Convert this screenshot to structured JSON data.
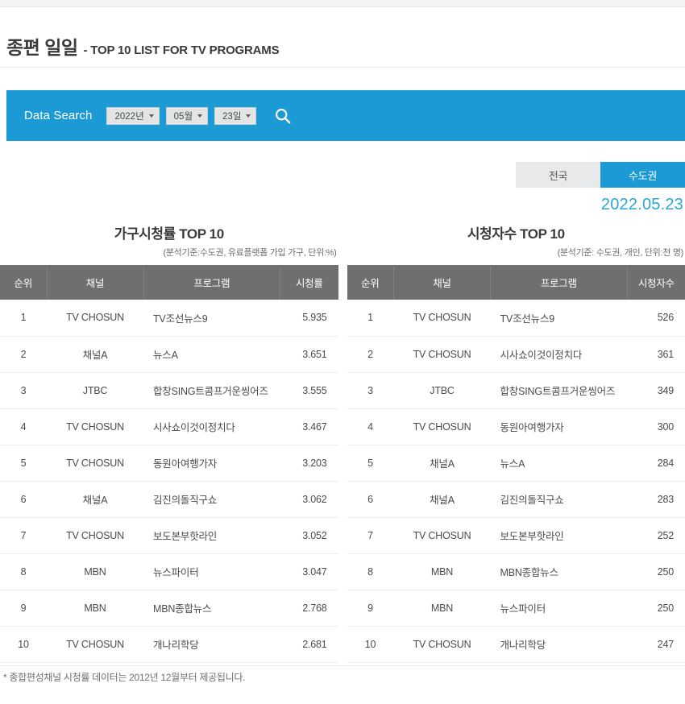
{
  "header": {
    "title_kr": "종편 일일",
    "title_en": "- TOP 10 LIST FOR TV PROGRAMS"
  },
  "search": {
    "label": "Data Search",
    "year": "2022년",
    "month": "05월",
    "day": "23일",
    "search_icon": "search-icon",
    "accent_color": "#1c9ad6"
  },
  "tabs": {
    "nationwide": "전국",
    "metropolitan": "수도권",
    "active": "수도권",
    "active_color": "#1c9ad6",
    "inactive_color": "#e8e9ea"
  },
  "date_label": "2022.05.23",
  "tables": [
    {
      "title": "가구시청률 TOP 10",
      "subtitle": "(분석기준:수도권, 유료플랫폼 가입 가구, 단위:%)",
      "columns": [
        "순위",
        "채널",
        "프로그램",
        "시청률"
      ],
      "rows": [
        {
          "rank": "1",
          "channel": "TV CHOSUN",
          "program": "TV조선뉴스9",
          "value": "5.935"
        },
        {
          "rank": "2",
          "channel": "채널A",
          "program": "뉴스A",
          "value": "3.651"
        },
        {
          "rank": "3",
          "channel": "JTBC",
          "program": "합창SING트콤프거운씽어즈",
          "value": "3.555"
        },
        {
          "rank": "4",
          "channel": "TV CHOSUN",
          "program": "시사쇼이것이정치다",
          "value": "3.467"
        },
        {
          "rank": "5",
          "channel": "TV CHOSUN",
          "program": "동원아여행가자",
          "value": "3.203"
        },
        {
          "rank": "6",
          "channel": "채널A",
          "program": "김진의돌직구쇼",
          "value": "3.062"
        },
        {
          "rank": "7",
          "channel": "TV CHOSUN",
          "program": "보도본부핫라인",
          "value": "3.052"
        },
        {
          "rank": "8",
          "channel": "MBN",
          "program": "뉴스파이터",
          "value": "3.047"
        },
        {
          "rank": "9",
          "channel": "MBN",
          "program": "MBN종합뉴스",
          "value": "2.768"
        },
        {
          "rank": "10",
          "channel": "TV CHOSUN",
          "program": "개나리학당",
          "value": "2.681"
        }
      ]
    },
    {
      "title": "시청자수 TOP 10",
      "subtitle": "(분석기준: 수도권, 개인, 단위:천 명)",
      "columns": [
        "순위",
        "채널",
        "프로그램",
        "시청자수"
      ],
      "rows": [
        {
          "rank": "1",
          "channel": "TV CHOSUN",
          "program": "TV조선뉴스9",
          "value": "526"
        },
        {
          "rank": "2",
          "channel": "TV CHOSUN",
          "program": "시사쇼이것이정치다",
          "value": "361"
        },
        {
          "rank": "3",
          "channel": "JTBC",
          "program": "합창SING트콤프거운씽어즈",
          "value": "349"
        },
        {
          "rank": "4",
          "channel": "TV CHOSUN",
          "program": "동원아여행가자",
          "value": "300"
        },
        {
          "rank": "5",
          "channel": "채널A",
          "program": "뉴스A",
          "value": "284"
        },
        {
          "rank": "6",
          "channel": "채널A",
          "program": "김진의돌직구쇼",
          "value": "283"
        },
        {
          "rank": "7",
          "channel": "TV CHOSUN",
          "program": "보도본부핫라인",
          "value": "252"
        },
        {
          "rank": "8",
          "channel": "MBN",
          "program": "MBN종합뉴스",
          "value": "250"
        },
        {
          "rank": "9",
          "channel": "MBN",
          "program": "뉴스파이터",
          "value": "250"
        },
        {
          "rank": "10",
          "channel": "TV CHOSUN",
          "program": "개나리학당",
          "value": "247"
        }
      ]
    }
  ],
  "footnote": "* 종합편성채널 시청률 데이터는 2012년 12월부터 제공됩니다.",
  "colors": {
    "value_blue": "#2aa5d4",
    "header_gray": "#6f6f6f"
  }
}
